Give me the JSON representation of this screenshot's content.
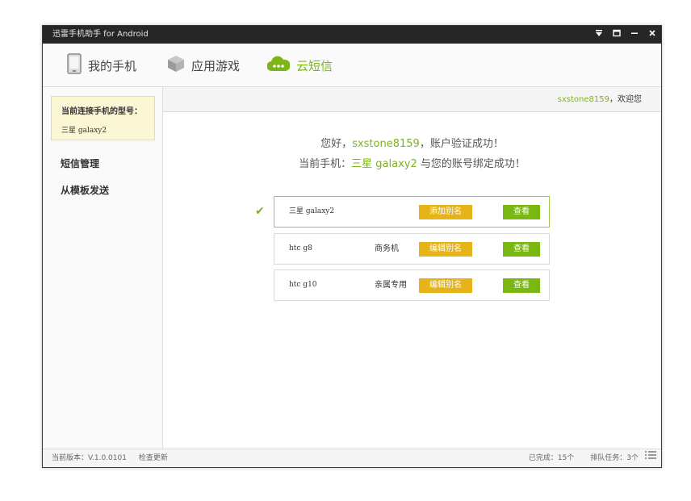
{
  "window": {
    "title": "迅雷手机助手  for Android"
  },
  "nav": {
    "tabs": [
      {
        "label": "我的手机",
        "icon": "phone-icon"
      },
      {
        "label": "应用游戏",
        "icon": "box-icon"
      },
      {
        "label": "云短信",
        "icon": "cloud-chat-icon"
      }
    ],
    "active": "云短信"
  },
  "sidebar": {
    "phone_label": "当前连接手机的型号：",
    "phone_model": "三星 galaxy2",
    "items": [
      {
        "label": "短信管理"
      },
      {
        "label": "从模板发送"
      }
    ]
  },
  "userbar": {
    "username": "sxstone8159",
    "greeting": "，欢迎您"
  },
  "message": {
    "line1_prefix": "您好，",
    "username": "sxstone8159",
    "line1_suffix": "，账户验证成功！",
    "line2_prefix": "当前手机：",
    "phone": "三星 galaxy2",
    "line2_suffix": " 与您的账号绑定成功！"
  },
  "devices": [
    {
      "name": "三星 galaxy2",
      "alias": "",
      "action": "添加别名",
      "view": "查看",
      "selected": true
    },
    {
      "name": "htc g8",
      "alias": "商务机",
      "action": "编辑别名",
      "view": "查看",
      "selected": false
    },
    {
      "name": "htc g10",
      "alias": "亲属专用",
      "action": "编辑别名",
      "view": "查看",
      "selected": false
    }
  ],
  "status": {
    "version": "当前版本：V.1.0.0101",
    "check_update": "检查更新",
    "completed": "已完成：15个",
    "queued": "排队任务：3个"
  },
  "colors": {
    "accent": "#7cb518",
    "alias_button": "#e6b418",
    "view_button": "#79b813",
    "titlebar": "#262626"
  }
}
